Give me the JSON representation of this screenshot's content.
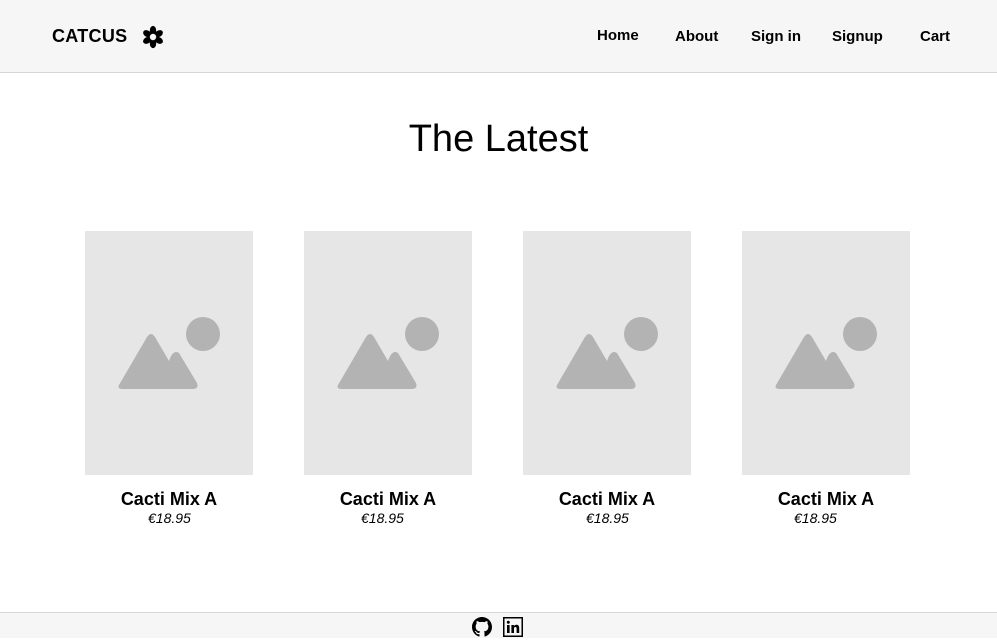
{
  "header": {
    "brand": "CATCUS",
    "brand_icon": "flower-icon",
    "nav": [
      {
        "label": "Home"
      },
      {
        "label": "About"
      },
      {
        "label": "Sign in"
      },
      {
        "label": "Signup"
      },
      {
        "label": "Cart"
      }
    ]
  },
  "main": {
    "title": "The Latest",
    "products": [
      {
        "name": "Cacti Mix A",
        "price": "€18.95",
        "image_icon": "image-placeholder-icon"
      },
      {
        "name": "Cacti Mix A",
        "price": "€18.95",
        "image_icon": "image-placeholder-icon"
      },
      {
        "name": "Cacti Mix A",
        "price": "€18.95",
        "image_icon": "image-placeholder-icon"
      },
      {
        "name": "Cacti Mix A",
        "price": "€18.95",
        "image_icon": "image-placeholder-icon"
      }
    ]
  },
  "footer": {
    "icons": [
      "github-icon",
      "linkedin-icon"
    ]
  },
  "colors": {
    "header_bg": "#f6f6f6",
    "placeholder_bg": "#e6e6e6",
    "placeholder_fg": "#b3b3b3"
  }
}
